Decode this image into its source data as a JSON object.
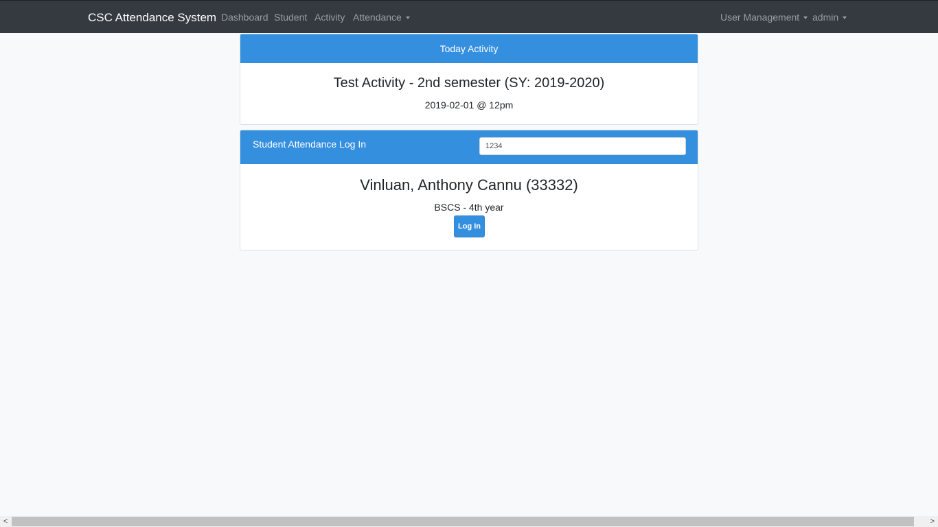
{
  "navbar": {
    "brand": "CSC Attendance System",
    "links": [
      "Dashboard",
      "Student",
      "Activity"
    ],
    "attendance_dropdown": "Attendance",
    "user_management_dropdown": "User Management",
    "admin_dropdown": "admin"
  },
  "today_activity": {
    "header": "Today Activity",
    "title": "Test Activity - 2nd semester (SY: 2019-2020)",
    "date": "2019-02-01 @ 12pm"
  },
  "attendance_login": {
    "header": "Student Attendance Log In",
    "id_input_value": "1234",
    "student_name": "Vinluan, Anthony Cannu (33332)",
    "course_year": "BSCS - 4th year",
    "login_button": "Log In"
  },
  "scrollbar": {
    "left_arrow": "<",
    "right_arrow": ">"
  },
  "colors": {
    "navbar_bg": "#343a40",
    "card_header_bg": "#358fdf",
    "page_bg": "#f8f9fa"
  }
}
